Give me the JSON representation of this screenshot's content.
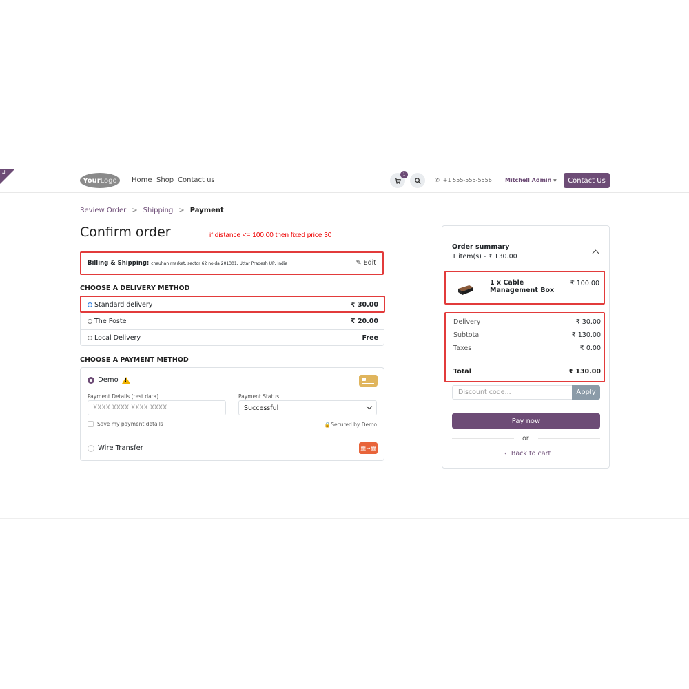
{
  "ribbon": {
    "glyph": "↲"
  },
  "header": {
    "logo_bold": "Your",
    "logo_light": "Logo",
    "nav": [
      "Home",
      "Shop",
      "Contact us"
    ],
    "cart_count": "1",
    "phone": "+1 555-555-5556",
    "user": "Mitchell Admin",
    "contact_button": "Contact Us"
  },
  "breadcrumb": {
    "items": [
      "Review Order",
      "Shipping"
    ],
    "separator": ">",
    "current": "Payment"
  },
  "page_title": "Confirm order",
  "annotation_note": "if distance <= 100.00 then fixed price 30",
  "billing": {
    "label": "Billing & Shipping:",
    "address": "chauhan market, sector 62 noida 201301, Uttar Pradesh UP, India",
    "edit": "Edit"
  },
  "delivery": {
    "title": "CHOOSE A DELIVERY METHOD",
    "methods": [
      {
        "name": "Standard delivery",
        "price": "₹ 30.00",
        "selected": true
      },
      {
        "name": "The Poste",
        "price": "₹ 20.00",
        "selected": false
      },
      {
        "name": "Local Delivery",
        "price": "Free",
        "selected": false
      }
    ]
  },
  "payment": {
    "title": "CHOOSE A PAYMENT METHOD",
    "demo_label": "Demo",
    "details_label": "Payment Details (test data)",
    "details_placeholder": "XXXX XXXX XXXX XXXX",
    "status_label": "Payment Status",
    "status_value": "Successful",
    "save_label": "Save my payment details",
    "secured_label": "Secured by Demo",
    "wire_label": "Wire Transfer",
    "wire_icon_text": "🏛→🏛"
  },
  "summary": {
    "title": "Order summary",
    "subtitle": "1 item(s) -  ₹ 130.00",
    "item_name": "1 x Cable Management Box",
    "item_price": "₹ 100.00",
    "rows": [
      {
        "label": "Delivery",
        "value": "₹ 30.00"
      },
      {
        "label": "Subtotal",
        "value": "₹ 130.00"
      },
      {
        "label": "Taxes",
        "value": "₹ 0.00"
      }
    ],
    "total_label": "Total",
    "total_value": "₹ 130.00",
    "discount_placeholder": "Discount code...",
    "apply": "Apply",
    "pay_now": "Pay now",
    "or": "or",
    "back": "Back to cart"
  },
  "colors": {
    "brand": "#6d4c76",
    "highlight": "#e23b3b",
    "note": "#ee0000"
  }
}
